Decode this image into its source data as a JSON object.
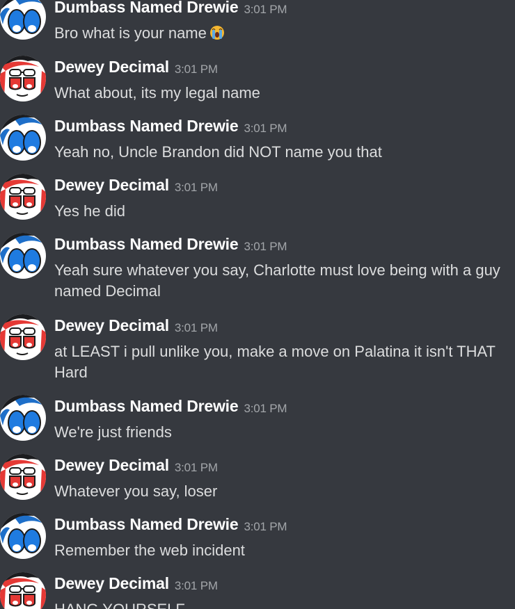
{
  "messages": [
    {
      "author": "Dumbass Named Drewie",
      "time": "3:01 PM",
      "text": "Bro what is your name",
      "avatar": "drewie-avatar",
      "emoji": "crying-emoji"
    },
    {
      "author": "Dewey Decimal",
      "time": "3:01 PM",
      "text": "What about, its my legal name",
      "avatar": "dewey-avatar"
    },
    {
      "author": "Dumbass Named Drewie",
      "time": "3:01 PM",
      "text": "Yeah no, Uncle Brandon did NOT name you that",
      "avatar": "drewie-avatar"
    },
    {
      "author": "Dewey Decimal",
      "time": "3:01 PM",
      "text": "Yes he did",
      "avatar": "dewey-avatar"
    },
    {
      "author": "Dumbass Named Drewie",
      "time": "3:01 PM",
      "text": "Yeah sure whatever you say, Charlotte must love being with a guy named Decimal",
      "avatar": "drewie-avatar"
    },
    {
      "author": "Dewey Decimal",
      "time": "3:01 PM",
      "text": "at LEAST i pull unlike you, make a move on Palatina it isn't THAT Hard",
      "avatar": "dewey-avatar"
    },
    {
      "author": "Dumbass Named Drewie",
      "time": "3:01 PM",
      "text": "We're just friends",
      "avatar": "drewie-avatar"
    },
    {
      "author": "Dewey Decimal",
      "time": "3:01 PM",
      "text": "Whatever you say, loser",
      "avatar": "dewey-avatar"
    },
    {
      "author": "Dumbass Named Drewie",
      "time": "3:01 PM",
      "text": "Remember the web incident",
      "avatar": "drewie-avatar"
    },
    {
      "author": "Dewey Decimal",
      "time": "3:01 PM",
      "text": "HANG YOURSELF",
      "avatar": "dewey-avatar"
    }
  ],
  "colors": {
    "background": "#36393f",
    "author": "#ffffff",
    "text": "#dcddde",
    "timestamp": "#a3a6aa"
  }
}
